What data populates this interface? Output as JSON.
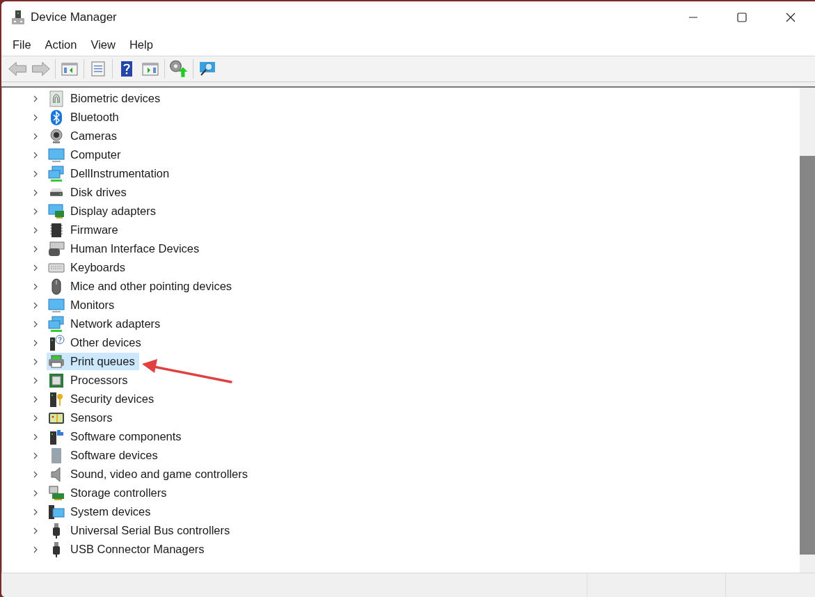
{
  "window": {
    "title": "Device Manager"
  },
  "menu": [
    {
      "label": "File"
    },
    {
      "label": "Action"
    },
    {
      "label": "View"
    },
    {
      "label": "Help"
    }
  ],
  "toolbar": [
    {
      "kind": "back",
      "disabled": true
    },
    {
      "kind": "forward",
      "disabled": true
    },
    {
      "kind": "separator"
    },
    {
      "kind": "console-tree",
      "disabled": false
    },
    {
      "kind": "separator"
    },
    {
      "kind": "properties",
      "disabled": false
    },
    {
      "kind": "separator"
    },
    {
      "kind": "help",
      "disabled": false
    },
    {
      "kind": "action-pane",
      "disabled": false
    },
    {
      "kind": "separator"
    },
    {
      "kind": "update-driver",
      "disabled": false
    },
    {
      "kind": "separator"
    },
    {
      "kind": "scan",
      "disabled": false
    }
  ],
  "tree": {
    "items": [
      {
        "label": "Biometric devices",
        "kind": "fingerprint",
        "expanded": false,
        "selected": false
      },
      {
        "label": "Bluetooth",
        "kind": "bluetooth",
        "expanded": false,
        "selected": false
      },
      {
        "label": "Cameras",
        "kind": "camera",
        "expanded": false,
        "selected": false
      },
      {
        "label": "Computer",
        "kind": "monitor",
        "expanded": false,
        "selected": false
      },
      {
        "label": "DellInstrumentation",
        "kind": "network",
        "expanded": false,
        "selected": false
      },
      {
        "label": "Disk drives",
        "kind": "disk",
        "expanded": false,
        "selected": false
      },
      {
        "label": "Display adapters",
        "kind": "display-adapter",
        "expanded": false,
        "selected": false
      },
      {
        "label": "Firmware",
        "kind": "chip",
        "expanded": false,
        "selected": false
      },
      {
        "label": "Human Interface Devices",
        "kind": "hid",
        "expanded": false,
        "selected": false
      },
      {
        "label": "Keyboards",
        "kind": "keyboard",
        "expanded": false,
        "selected": false
      },
      {
        "label": "Mice and other pointing devices",
        "kind": "mouse",
        "expanded": false,
        "selected": false
      },
      {
        "label": "Monitors",
        "kind": "monitor",
        "expanded": false,
        "selected": false
      },
      {
        "label": "Network adapters",
        "kind": "network",
        "expanded": false,
        "selected": false
      },
      {
        "label": "Other devices",
        "kind": "unknown",
        "expanded": false,
        "selected": false
      },
      {
        "label": "Print queues",
        "kind": "printer",
        "expanded": false,
        "selected": true
      },
      {
        "label": "Processors",
        "kind": "processor",
        "expanded": false,
        "selected": false
      },
      {
        "label": "Security devices",
        "kind": "security",
        "expanded": false,
        "selected": false
      },
      {
        "label": "Sensors",
        "kind": "sensor",
        "expanded": false,
        "selected": false
      },
      {
        "label": "Software components",
        "kind": "component",
        "expanded": false,
        "selected": false
      },
      {
        "label": "Software devices",
        "kind": "software-device",
        "expanded": false,
        "selected": false
      },
      {
        "label": "Sound, video and game controllers",
        "kind": "speaker",
        "expanded": false,
        "selected": false
      },
      {
        "label": "Storage controllers",
        "kind": "storage",
        "expanded": false,
        "selected": false
      },
      {
        "label": "System devices",
        "kind": "system",
        "expanded": false,
        "selected": false
      },
      {
        "label": "Universal Serial Bus controllers",
        "kind": "usb",
        "expanded": false,
        "selected": false
      },
      {
        "label": "USB Connector Managers",
        "kind": "usb",
        "expanded": false,
        "selected": false
      }
    ]
  }
}
